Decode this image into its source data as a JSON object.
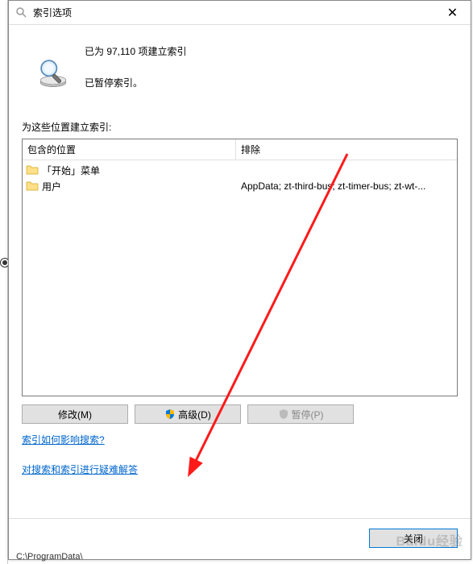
{
  "titlebar": {
    "title": "索引选项"
  },
  "info": {
    "indexed_status": "已为 97,110 项建立索引",
    "paused_status": "已暂停索引。"
  },
  "section": {
    "label": "为这些位置建立索引:"
  },
  "columns": {
    "included": "包含的位置",
    "excluded": "排除"
  },
  "rows": [
    {
      "name": "「开始」菜单",
      "excluded": ""
    },
    {
      "name": "用户",
      "excluded": "AppData; zt-third-bus; zt-timer-bus; zt-wt-..."
    }
  ],
  "buttons": {
    "modify": "修改(M)",
    "advanced": "高级(D)",
    "pause": "暂停(P)",
    "close": "关闭"
  },
  "links": {
    "how_affect": "索引如何影响搜索?",
    "troubleshoot": "对搜索和索引进行疑难解答"
  },
  "watermark": "Baidu经验",
  "status_bar": "C:\\ProgramData\\"
}
